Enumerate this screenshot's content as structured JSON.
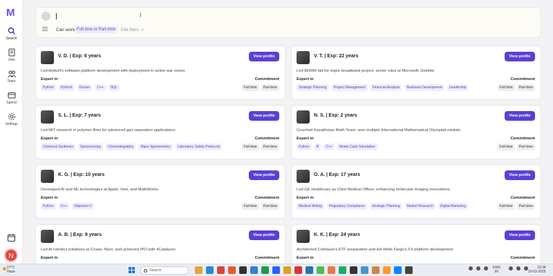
{
  "app": {
    "logo_letter": "M",
    "accent": "#5b3fd6",
    "avatar_letter": "N"
  },
  "nav": [
    {
      "label": "Search",
      "icon": "search-icon"
    },
    {
      "label": "Jobs",
      "icon": "document-icon"
    },
    {
      "label": "Team",
      "icon": "team-icon"
    },
    {
      "label": "Spend",
      "icon": "wallet-icon"
    },
    {
      "label": "Settings",
      "icon": "gear-icon"
    }
  ],
  "search": {
    "filter_label": "Can work",
    "filter_value": "Full-time or Part-time",
    "edit_filters": "Edit filters ↗"
  },
  "labels": {
    "view_profile": "View profile",
    "expert_in": "Expert in",
    "commitment": "Commitment",
    "full_time": "Full-time",
    "part_time": "Part-time"
  },
  "candidates": [
    {
      "name": "V. D. | Exp: 6 years",
      "summary": "Led Anduril's software platform development with deployment in active war zones.",
      "skills": [
        "Python",
        "Pytorch",
        "Docker",
        "C++",
        "SQL"
      ]
    },
    {
      "name": "V. T. | Exp: 22 years",
      "summary": "Led $600M bid for major broadband project: senior roles at Microsoft, Deloitte.",
      "skills": [
        "Strategic Planning",
        "Project Management",
        "Financial Analysis",
        "Business Development",
        "Leadership"
      ]
    },
    {
      "name": "S. L. | Exp: 7 years",
      "summary": "Led MIT research in polymer films for advanced gas separation applications.",
      "skills": [
        "Chemical Synthesis",
        "Spectroscopy",
        "Chromatography",
        "Mass Spectrometry",
        "Laboratory Safety Protocols"
      ]
    },
    {
      "name": "N. S. | Exp: 2 years",
      "summary": "Coached Kazakhstan Math Team; won multiple International Mathematical Olympiad medals.",
      "skills": [
        "Python",
        "R",
        "C++",
        "Monte Carlo Simulation"
      ]
    },
    {
      "name": "K. G. | Exp: 10 years",
      "summary": "Developed AI and ML technologies at Apple, Intel, and MathWorks.",
      "skills": [
        "Python",
        "C++",
        "Objective-C"
      ]
    },
    {
      "name": "O. A. | Exp: 17 years",
      "summary": "Led GE Healthcare as Chief Medical Officer, enhancing molecular imaging innovations.",
      "skills": [
        "Medical Writing",
        "Regulatory Compliance",
        "Strategic Planning",
        "Market Research",
        "Digital Marketing"
      ]
    },
    {
      "name": "A. B. | Exp: 9 years",
      "summary": "Led AI robotics initiatives at Cruise, Nuro, and achieved IPO with 4Catalyzer.",
      "skills": []
    },
    {
      "name": "K. K. | Exp: 24 years",
      "summary": "Architected Coinbase's ETF preparation and led Wells Fargo's FX platform development.",
      "skills": []
    }
  ],
  "taskbar": {
    "temp": "27°C",
    "weather": "Haze",
    "search_placeholder": "Search",
    "lang_1": "ENG",
    "lang_2": "IN",
    "time": "19:34",
    "date": "10-03-2025",
    "app_colors": [
      "#e8a33a",
      "#2b8ad8",
      "#d04a3a",
      "#e55a2b",
      "#333333",
      "#3a7bd5",
      "#1f9a4c",
      "#2962ff",
      "#e0a020",
      "#d33",
      "#27a",
      "#5b5",
      "#e74",
      "#2a6",
      "#333",
      "#49c",
      "#c84",
      "#f93",
      "#0a84ff",
      "#444"
    ]
  }
}
